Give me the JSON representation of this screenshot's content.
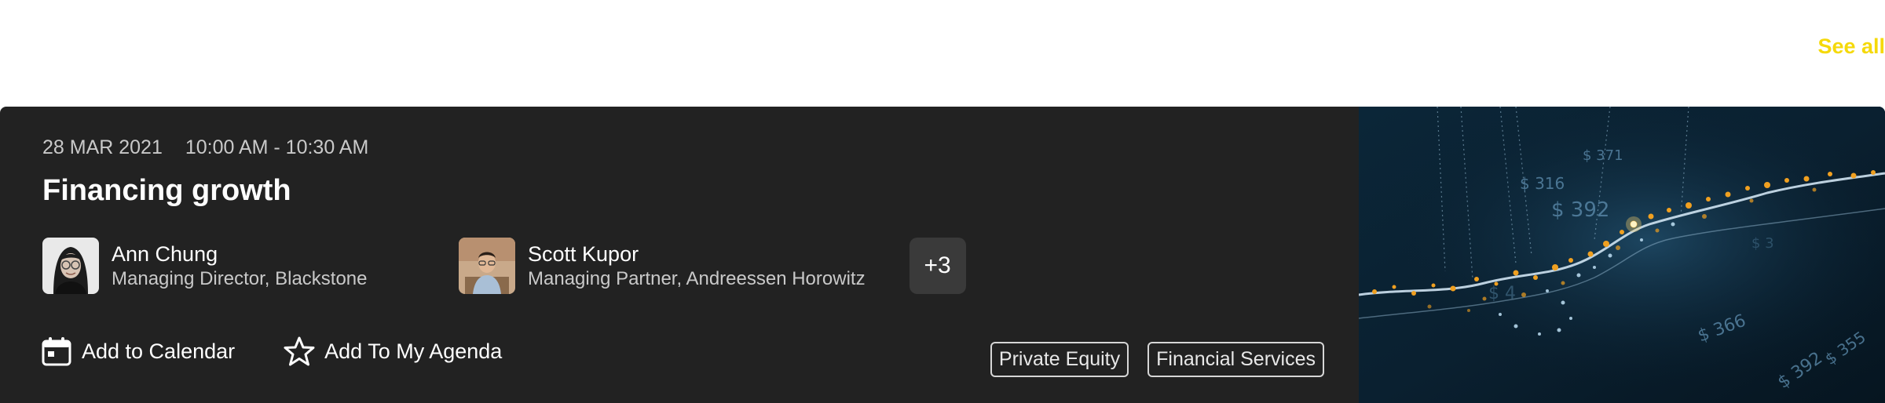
{
  "header": {
    "see_all_label": "See all"
  },
  "event": {
    "date": "28 MAR 2021",
    "time": "10:00 AM - 10:30 AM",
    "title": "Financing growth",
    "speakers": [
      {
        "name": "Ann Chung",
        "role": "Managing Director, Blackstone"
      },
      {
        "name": "Scott Kupor",
        "role": "Managing Partner, Andreessen Horowitz"
      }
    ],
    "more_speakers_label": "+3",
    "actions": {
      "calendar_label": "Add to Calendar",
      "calendar_icon": "calendar-icon",
      "agenda_label": "Add To My Agenda",
      "agenda_icon": "star-icon"
    },
    "tags": [
      "Private Equity",
      "Financial Services"
    ]
  },
  "colors": {
    "accent": "#f5d90a",
    "card_background": "#222222",
    "chip_background": "#3a3a3a"
  }
}
